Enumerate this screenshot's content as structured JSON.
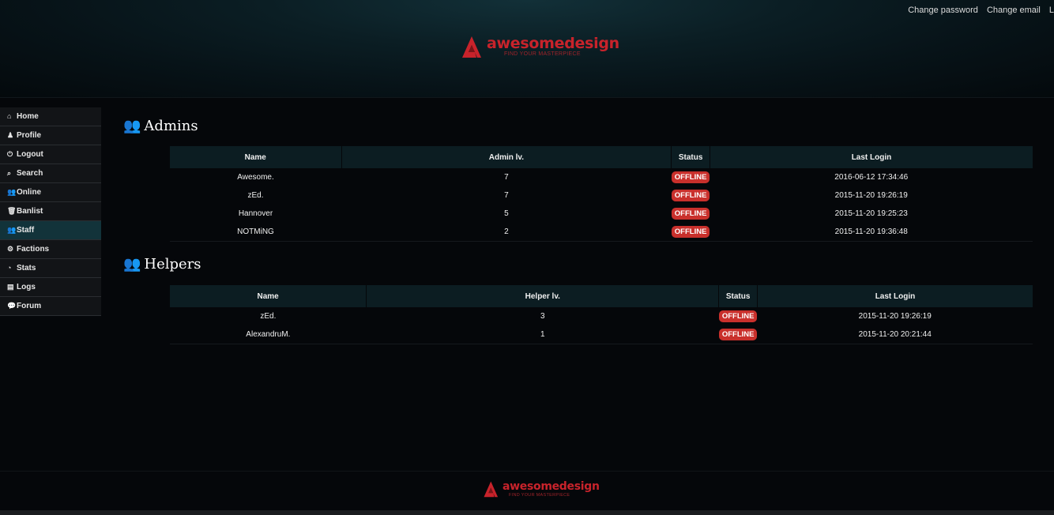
{
  "header": {
    "links": [
      "Change password",
      "Change email",
      "L"
    ],
    "logo": {
      "brand": "awesomedesign",
      "tagline": "FIND YOUR MASTERPIECE"
    }
  },
  "sidebar": {
    "items": [
      {
        "label": "Home",
        "icon": "home-icon"
      },
      {
        "label": "Profile",
        "icon": "user-icon"
      },
      {
        "label": "Logout",
        "icon": "power-icon"
      },
      {
        "label": "Search",
        "icon": "search-icon"
      },
      {
        "label": "Online",
        "icon": "users-icon"
      },
      {
        "label": "Banlist",
        "icon": "trash-icon"
      },
      {
        "label": "Staff",
        "icon": "users-icon",
        "active": true
      },
      {
        "label": "Factions",
        "icon": "gears-icon"
      },
      {
        "label": "Stats",
        "icon": "gauge-icon"
      },
      {
        "label": "Logs",
        "icon": "book-icon"
      },
      {
        "label": "Forum",
        "icon": "comments-icon"
      }
    ]
  },
  "admins": {
    "title": "Admins",
    "columns": [
      "Name",
      "Admin lv.",
      "Status",
      "Last Login"
    ],
    "rows": [
      [
        "Awesome.",
        "7",
        "OFFLINE",
        "2016-06-12 17:34:46"
      ],
      [
        "zEd.",
        "7",
        "OFFLINE",
        "2015-11-20 19:26:19"
      ],
      [
        "Hannover",
        "5",
        "OFFLINE",
        "2015-11-20 19:25:23"
      ],
      [
        "NOTMiNG",
        "2",
        "OFFLINE",
        "2015-11-20 19:36:48"
      ]
    ]
  },
  "helpers": {
    "title": "Helpers",
    "columns": [
      "Name",
      "Helper lv.",
      "Status",
      "Last Login"
    ],
    "rows": [
      [
        "zEd.",
        "3",
        "OFFLINE",
        "2015-11-20 19:26:19"
      ],
      [
        "AlexandruM.",
        "1",
        "OFFLINE",
        "2015-11-20 20:21:44"
      ]
    ]
  },
  "footer": {
    "logo": {
      "brand": "awesomedesign",
      "tagline": "FIND YOUR MASTERPIECE"
    }
  },
  "colors": {
    "accent": "#c8232b",
    "status_offline": "#c9302c",
    "active_nav": "#12333a"
  }
}
